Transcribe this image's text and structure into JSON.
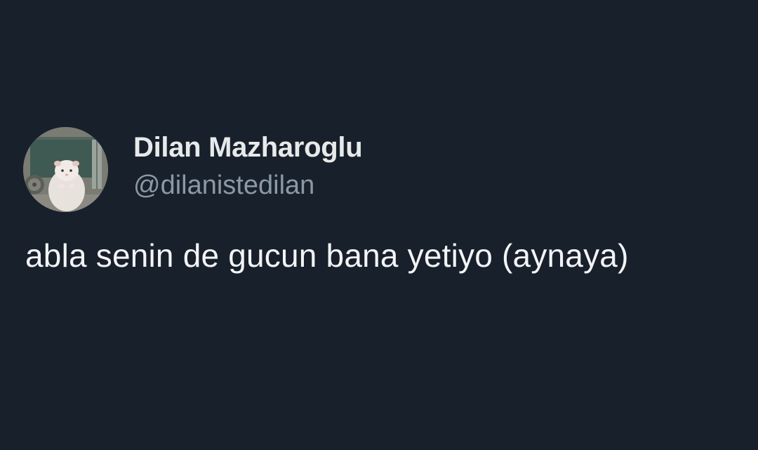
{
  "tweet": {
    "display_name": "Dilan Mazharoglu",
    "handle": "@dilanistedilan",
    "text": "abla senin de gucun bana yetiyo (aynaya)"
  },
  "colors": {
    "background": "#18202b",
    "name": "#e7e9ea",
    "handle": "#8b98a5",
    "text": "#f2f4f5"
  },
  "icons": {
    "avatar": "hamster-photo-avatar"
  }
}
